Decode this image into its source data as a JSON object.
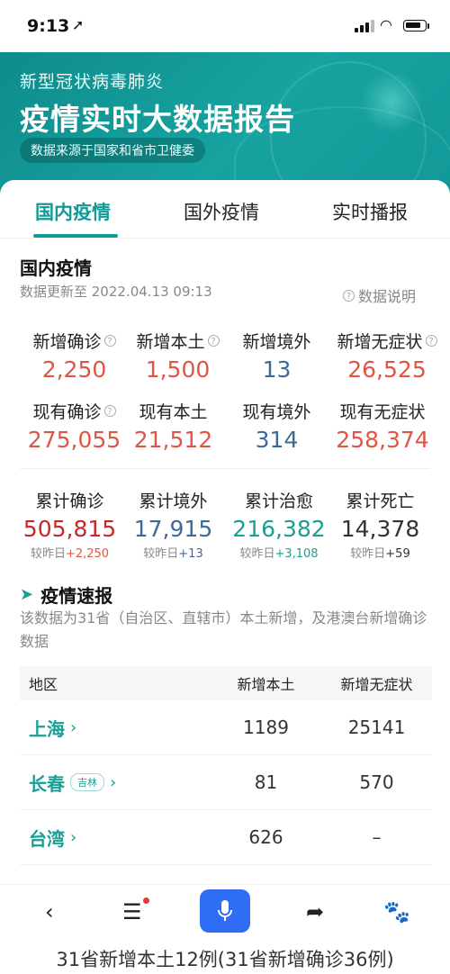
{
  "status": {
    "time": "9:13"
  },
  "banner": {
    "subtitle": "新型冠状病毒肺炎",
    "title": "疫情实时大数据报告",
    "source": "数据来源于国家和省市卫健委"
  },
  "tabs": [
    "国内疫情",
    "国外疫情",
    "实时播报"
  ],
  "section": {
    "title": "国内疫情",
    "updated": "数据更新至 2022.04.13 09:13",
    "explain": "数据说明"
  },
  "stats_row1": [
    {
      "label": "新增确诊",
      "value": "2,250"
    },
    {
      "label": "新增本土",
      "value": "1,500"
    },
    {
      "label": "新增境外",
      "value": "13"
    },
    {
      "label": "新增无症状",
      "value": "26,525"
    }
  ],
  "stats_row2": [
    {
      "label": "现有确诊",
      "value": "275,055"
    },
    {
      "label": "现有本土",
      "value": "21,512"
    },
    {
      "label": "现有境外",
      "value": "314"
    },
    {
      "label": "现有无症状",
      "value": "258,374"
    }
  ],
  "stats_row3": [
    {
      "label": "累计确诊",
      "value": "505,815",
      "compare_label": "较昨日",
      "compare": "+2,250"
    },
    {
      "label": "累计境外",
      "value": "17,915",
      "compare_label": "较昨日",
      "compare": "+13"
    },
    {
      "label": "累计治愈",
      "value": "216,382",
      "compare_label": "较昨日",
      "compare": "+3,108"
    },
    {
      "label": "累计死亡",
      "value": "14,378",
      "compare_label": "较昨日",
      "compare": "+59"
    }
  ],
  "news": {
    "title": "疫情速报",
    "desc": "该数据为31省（自治区、直辖市）本土新增，及港澳台新增确诊数据"
  },
  "table": {
    "headers": [
      "地区",
      "新增本土",
      "新增无症状"
    ],
    "rows": [
      {
        "region": "上海",
        "tag": "",
        "local": "1189",
        "asym": "25141"
      },
      {
        "region": "长春",
        "tag": "吉林",
        "local": "81",
        "asym": "570"
      },
      {
        "region": "台湾",
        "tag": "",
        "local": "626",
        "asym": "–"
      }
    ]
  },
  "caption": "31省新增本土12例(31省新增确诊36例)",
  "colors": {
    "accent": "#129a97",
    "red": "#e05545",
    "blue": "#3e6a9a",
    "teal": "#1a9e95",
    "mic": "#2f6df5"
  }
}
